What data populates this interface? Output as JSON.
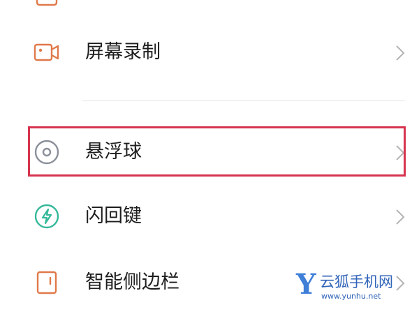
{
  "settings": {
    "items": [
      {
        "label": "屏幕录制",
        "icon": "video-camera-icon",
        "icon_color": "#e0794a"
      },
      {
        "label": "悬浮球",
        "icon": "floating-ball-icon",
        "icon_color": "#8a8f9a",
        "highlighted": true
      },
      {
        "label": "闪回键",
        "icon": "lightning-bolt-icon",
        "icon_color": "#35b89a"
      },
      {
        "label": "智能侧边栏",
        "icon": "sidebar-panel-icon",
        "icon_color": "#e0794a"
      }
    ]
  },
  "highlight": {
    "color": "#d6344e"
  },
  "watermark": {
    "mark": "Y",
    "brand": "云狐手机网",
    "url": "www.yunhu.net"
  }
}
